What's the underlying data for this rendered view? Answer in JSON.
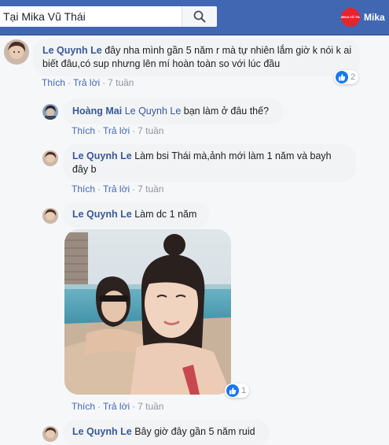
{
  "search": {
    "value": "Tại Mika Vũ Thái",
    "placeholder": ""
  },
  "profile": {
    "name": "Mika",
    "logo_text": "MIKA VŨ THÁI"
  },
  "actions": {
    "like": "Thích",
    "reply": "Trả lời",
    "separator": "·"
  },
  "comments": [
    {
      "author": "Le Quynh Le",
      "mention": "",
      "text": "đây nha mình gần 5 năm r mà tự nhiên lắm giờ k nói k ai biết đâu,có sup nhưng lên mí hoàn toàn so với lúc đầu",
      "time": "7 tuần",
      "reactions": "2"
    },
    {
      "author": "Hoàng Mai",
      "mention": "Le Quynh Le",
      "text": "bạn làm ở đâu thế?",
      "time": "7 tuần"
    },
    {
      "author": "Le Quynh Le",
      "mention": "",
      "text": "Làm bsi Thái mà,ảnh mới làm 1 năm và bayh đây b",
      "time": "7 tuần"
    },
    {
      "author": "Le Quynh Le",
      "mention": "",
      "text": "Làm dc 1 năm",
      "time": "7 tuần",
      "reactions": "1"
    },
    {
      "author": "Le Quynh Le",
      "mention": "",
      "text": "Bây giờ đây gần 5 năm ruid"
    }
  ],
  "colors": {
    "header": "#4267b2",
    "link": "#385898",
    "bubble": "#f2f3f5",
    "like": "#1877f2",
    "logo": "#e8232b"
  }
}
